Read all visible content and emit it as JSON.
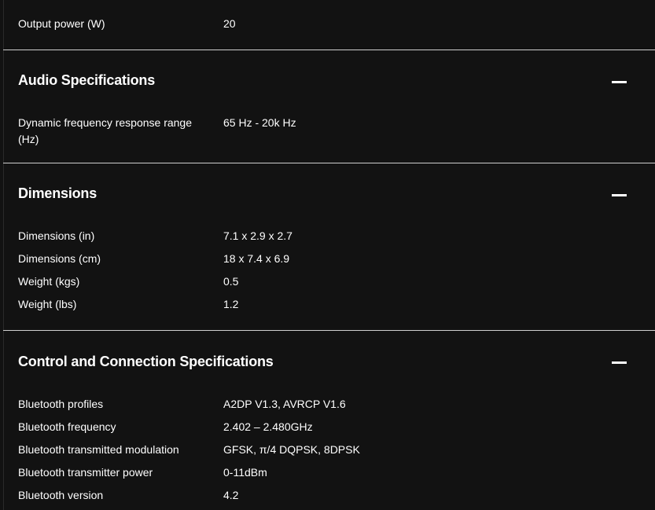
{
  "top_spec": {
    "label": "Output power (W)",
    "value": "20"
  },
  "sections": [
    {
      "title": "Audio Specifications",
      "collapse_icon": "minus-icon",
      "rows": [
        {
          "label": "Dynamic frequency response range (Hz)",
          "value": "65 Hz - 20k Hz"
        }
      ]
    },
    {
      "title": "Dimensions",
      "collapse_icon": "minus-icon",
      "rows": [
        {
          "label": "Dimensions (in)",
          "value": "7.1 x 2.9 x 2.7"
        },
        {
          "label": "Dimensions (cm)",
          "value": "18 x 7.4 x 6.9"
        },
        {
          "label": "Weight (kgs)",
          "value": "0.5"
        },
        {
          "label": "Weight (lbs)",
          "value": "1.2"
        }
      ]
    },
    {
      "title": "Control and Connection Specifications",
      "collapse_icon": "minus-icon",
      "rows": [
        {
          "label": "Bluetooth profiles",
          "value": "A2DP V1.3, AVRCP V1.6"
        },
        {
          "label": "Bluetooth frequency",
          "value": "2.402 – 2.480GHz"
        },
        {
          "label": "Bluetooth transmitted modulation",
          "value": "GFSK, π/4 DQPSK, 8DPSK"
        },
        {
          "label": "Bluetooth transmitter power",
          "value": "0-11dBm"
        },
        {
          "label": "Bluetooth version",
          "value": "4.2"
        }
      ]
    }
  ],
  "colors": {
    "background": "#121212",
    "text": "#ffffff",
    "divider": "#cfcfcf"
  }
}
